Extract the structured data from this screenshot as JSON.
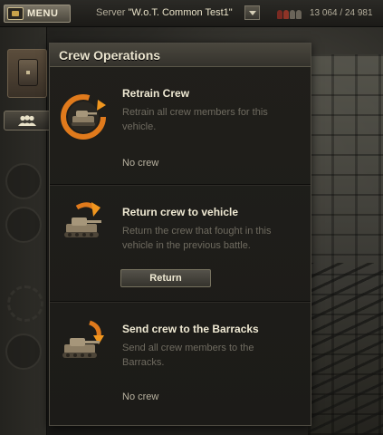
{
  "topbar": {
    "menu_label": "MENU",
    "server_prefix": "Server",
    "server_name": "\"W.o.T. Common Test1\"",
    "online_count": "13 064 / 24 981"
  },
  "popup": {
    "title": "Crew Operations",
    "operations": [
      {
        "title": "Retrain Crew",
        "description": "Retrain all crew members for this vehicle.",
        "status": "No crew",
        "icon": "retrain-crew-icon"
      },
      {
        "title": "Return crew to vehicle",
        "description": "Return the crew that fought in this vehicle in the previous battle.",
        "button_label": "Return",
        "icon": "return-crew-icon"
      },
      {
        "title": "Send crew to the Barracks",
        "description": "Send all crew members to the Barracks.",
        "status": "No crew",
        "icon": "send-to-barracks-icon"
      }
    ]
  },
  "colors": {
    "accent_orange": "#e07a1c",
    "panel": "#1f1e1a",
    "header": "#3e3b33"
  }
}
